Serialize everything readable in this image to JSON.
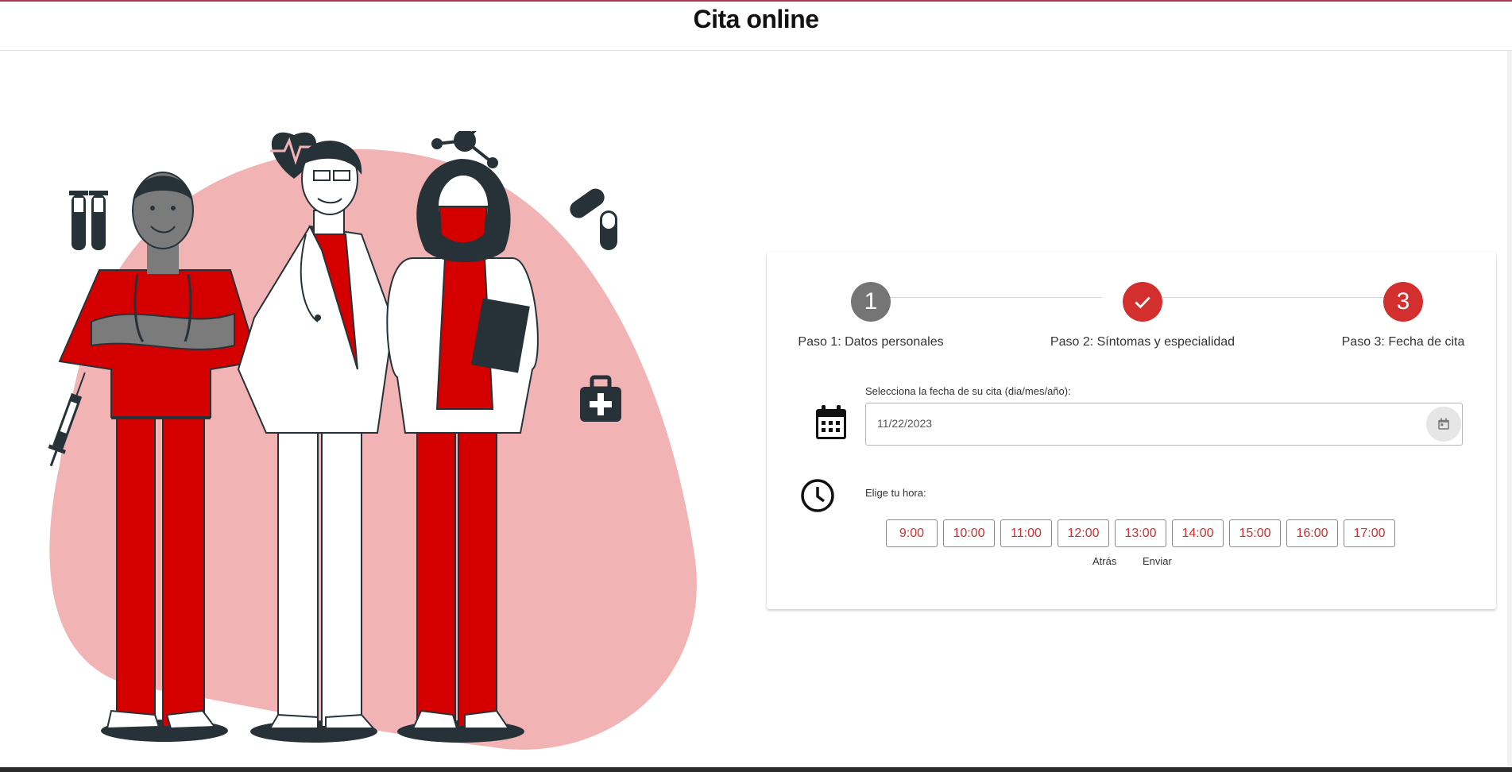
{
  "header": {
    "title": "Cita online"
  },
  "colors": {
    "accent_red": "#d32f2f",
    "illustration_red": "#d40000",
    "blob_pink": "#f1b3b4",
    "dark": "#263238",
    "step_inactive": "#757575"
  },
  "stepper": {
    "steps": [
      {
        "number": "1",
        "label": "Paso 1: Datos personales",
        "state": "inactive"
      },
      {
        "number": "",
        "label": "Paso 2: Síntomas y especialidad",
        "state": "completed",
        "icon": "check-icon"
      },
      {
        "number": "3",
        "label": "Paso 3: Fecha de cita",
        "state": "active"
      }
    ]
  },
  "date_field": {
    "label": "Selecciona la fecha de su cita (dia/mes/año):",
    "value": "11/22/2023",
    "leading_icon": "calendar-icon",
    "picker_icon": "calendar-picker-icon"
  },
  "time_field": {
    "label": "Elige tu hora:",
    "leading_icon": "clock-icon",
    "slots": [
      "9:00",
      "10:00",
      "11:00",
      "12:00",
      "13:00",
      "14:00",
      "15:00",
      "16:00",
      "17:00"
    ]
  },
  "actions": {
    "back_label": "Atrás",
    "submit_label": "Enviar"
  }
}
